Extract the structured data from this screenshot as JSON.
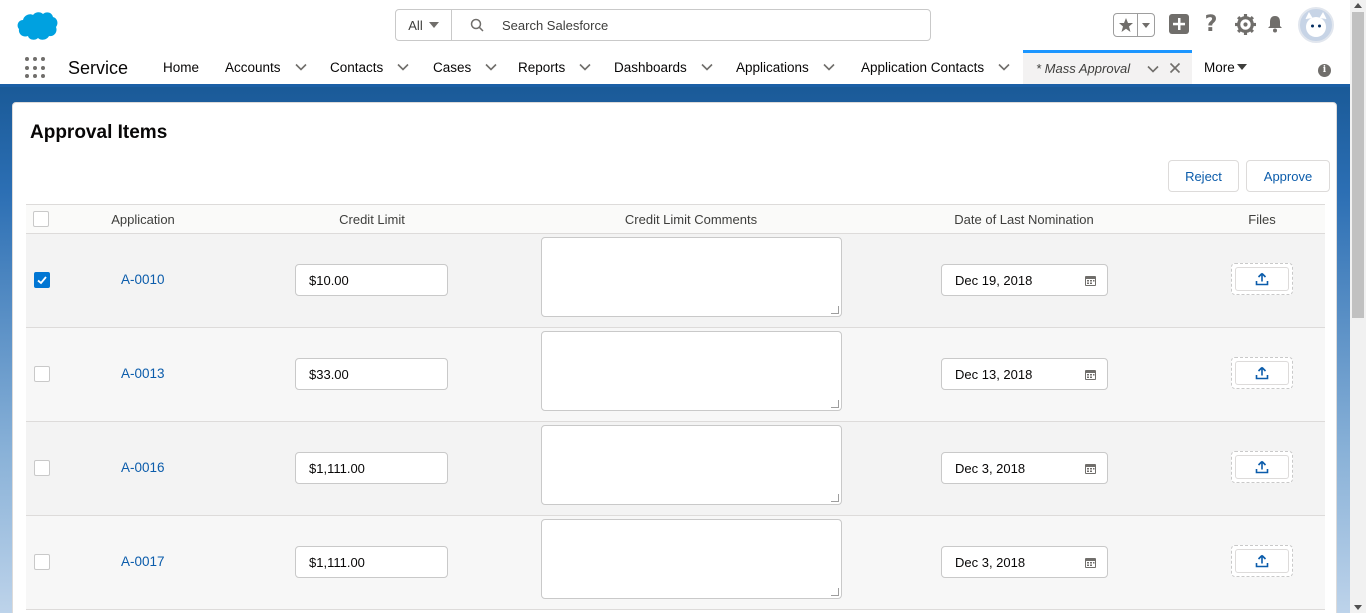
{
  "header": {
    "search_scope": "All",
    "search_placeholder": "Search Salesforce"
  },
  "nav": {
    "app_name": "Service",
    "items": [
      {
        "label": "Home"
      },
      {
        "label": "Accounts"
      },
      {
        "label": "Contacts"
      },
      {
        "label": "Cases"
      },
      {
        "label": "Reports"
      },
      {
        "label": "Dashboards"
      },
      {
        "label": "Applications"
      },
      {
        "label": "Application Contacts"
      }
    ],
    "active_tab": "* Mass Approval",
    "more_label": "More"
  },
  "card": {
    "title": "Approval Items",
    "reject_label": "Reject",
    "approve_label": "Approve",
    "columns": [
      "Application",
      "Credit Limit",
      "Credit Limit Comments",
      "Date of Last Nomination",
      "Files"
    ],
    "rows": [
      {
        "application": "A-0010",
        "credit_limit": "$10.00",
        "comments": "",
        "date": "Dec 19, 2018",
        "checked": true
      },
      {
        "application": "A-0013",
        "credit_limit": "$33.00",
        "comments": "",
        "date": "Dec 13, 2018",
        "checked": false
      },
      {
        "application": "A-0016",
        "credit_limit": "$1,111.00",
        "comments": "",
        "date": "Dec 3, 2018",
        "checked": false
      },
      {
        "application": "A-0017",
        "credit_limit": "$1,111.00",
        "comments": "",
        "date": "Dec 3, 2018",
        "checked": false
      }
    ]
  },
  "colors": {
    "brand_blue": "#0176d3",
    "link_blue": "#0b5cab",
    "nav_underline": "#1b96ff"
  },
  "icons": [
    "salesforce-cloud-logo",
    "search-icon",
    "star-icon",
    "add-icon",
    "help-icon",
    "gear-icon",
    "bell-icon",
    "avatar",
    "app-launcher-icon",
    "chevron-down-icon",
    "close-icon",
    "info-icon",
    "calendar-icon",
    "upload-icon"
  ]
}
